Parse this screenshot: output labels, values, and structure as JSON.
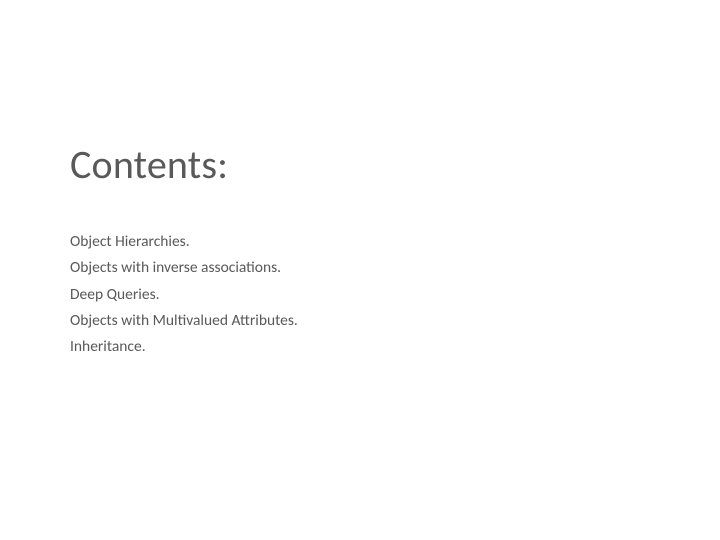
{
  "slide": {
    "title": "Contents:",
    "items": [
      "Object Hierarchies.",
      "Objects with inverse associations.",
      "Deep Queries.",
      "Objects with Multivalued Attributes.",
      "Inheritance."
    ]
  }
}
